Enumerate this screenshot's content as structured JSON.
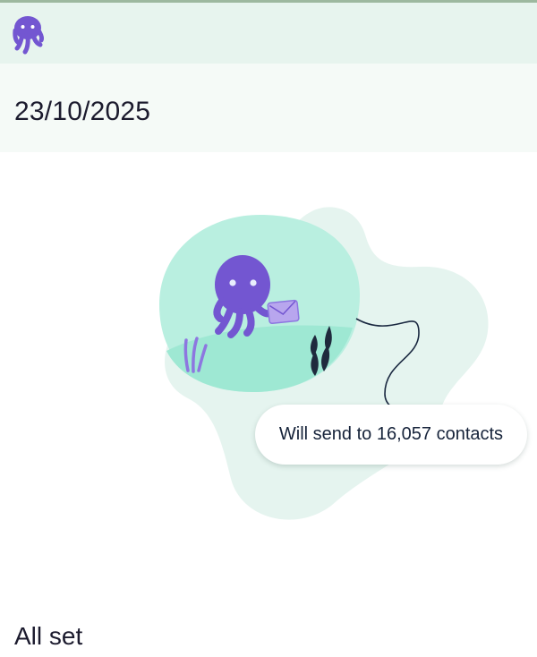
{
  "header": {
    "logo_icon": "octopus-logo-icon"
  },
  "campaign": {
    "date": "23/10/2025",
    "send_summary": "Will send to 16,057 contacts",
    "status": "All set"
  },
  "illustration": {
    "icon": "octopus-with-envelope-illustration"
  },
  "colors": {
    "brand_purple": "#7356d1",
    "header_bg": "#e7f4ee",
    "date_band_bg": "#f5faf7",
    "bubble_teal": "#b9efe0",
    "blob_mint": "#e5f4ef"
  }
}
